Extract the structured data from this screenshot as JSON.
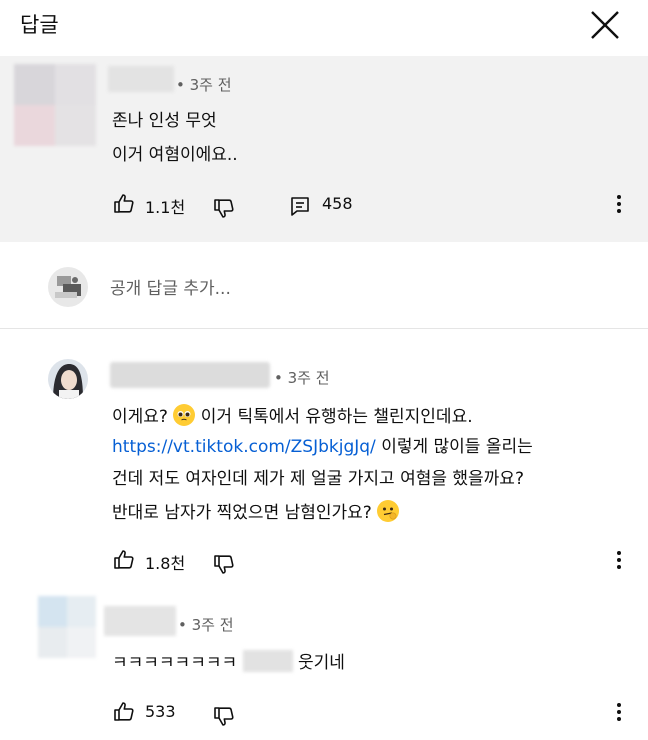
{
  "header": {
    "title": "답글"
  },
  "parent_comment": {
    "time": "• 3주 전",
    "lines": [
      "존나 인성 무엇",
      "이거 여혐이에요.."
    ],
    "likes": "1.1천",
    "replies": "458"
  },
  "add_reply": {
    "placeholder": "공개 답글 추가..."
  },
  "reply1": {
    "time": "• 3주 전",
    "line1_a": "이게요?",
    "line1_b": "이거 틱톡에서 유행하는 챌린지인데요.",
    "link": "https://vt.tiktok.com/ZSJbkjgJq/",
    "line2_rest": "이렇게 많이들 올리는",
    "line3": "건데 저도 여자인데 제가 제 얼굴 가지고 여혐을 했을까요?",
    "line4": "반대로 남자가 찍었으면 남혐인가요?",
    "likes": "1.8천"
  },
  "reply2": {
    "time": "• 3주 전",
    "text_a": "ㅋㅋㅋㅋㅋㅋㅋㅋ",
    "text_b": "웃기네",
    "likes": "533"
  },
  "colors": {
    "link": "#065fd4",
    "parent_bg": "#f2f2f2",
    "meta": "#606060"
  },
  "icons": [
    "close-icon",
    "thumbs-up-icon",
    "thumbs-down-icon",
    "reply-icon",
    "more-vert-icon",
    "emoji-pleading-icon",
    "emoji-thinking-icon"
  ]
}
